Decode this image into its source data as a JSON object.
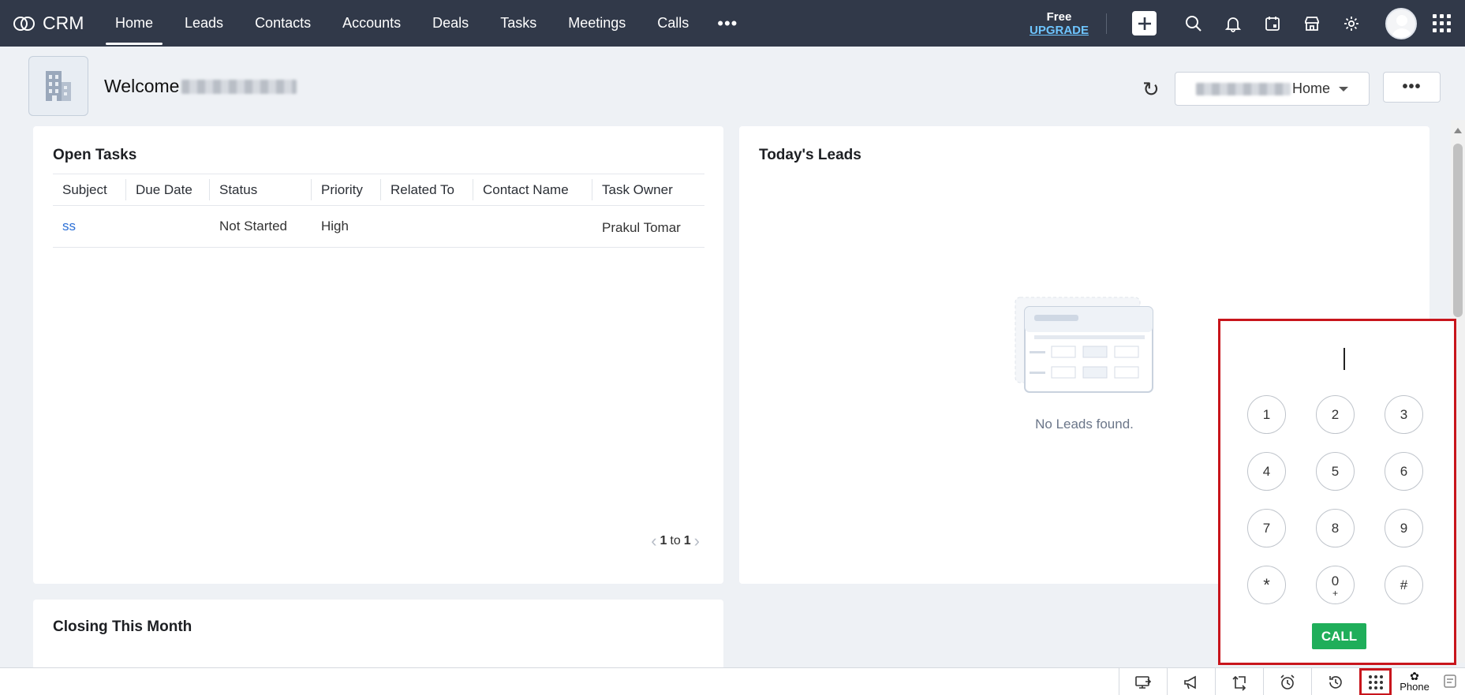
{
  "app": {
    "name": "CRM"
  },
  "nav": {
    "items": [
      {
        "label": "Home",
        "active": true
      },
      {
        "label": "Leads"
      },
      {
        "label": "Contacts"
      },
      {
        "label": "Accounts"
      },
      {
        "label": "Deals"
      },
      {
        "label": "Tasks"
      },
      {
        "label": "Meetings"
      },
      {
        "label": "Calls"
      }
    ],
    "more": "•••",
    "upgrade": {
      "free": "Free",
      "link": "UPGRADE"
    },
    "icons": [
      "plus-icon",
      "search-icon",
      "bell-icon",
      "calendar-icon",
      "marketplace-icon",
      "gear-icon",
      "avatar",
      "apps-grid-icon"
    ]
  },
  "welcome": {
    "prefix": "Welcome",
    "refresh_glyph": "↻",
    "home_view": "Home",
    "more": "•••"
  },
  "open_tasks": {
    "title": "Open Tasks",
    "columns": [
      "Subject",
      "Due Date",
      "Status",
      "Priority",
      "Related To",
      "Contact Name",
      "Task Owner"
    ],
    "rows": [
      {
        "subject": "ss",
        "due_date": "",
        "status": "Not Started",
        "priority": "High",
        "related_to": "",
        "contact_name": "",
        "task_owner": "Prakul Tomar"
      }
    ],
    "pager": {
      "from": "1",
      "sep": "to",
      "to": "1"
    }
  },
  "todays_leads": {
    "title": "Today's Leads",
    "empty_text": "No Leads found."
  },
  "closing": {
    "title": "Closing This Month"
  },
  "dialpad": {
    "keys": [
      {
        "main": "1",
        "sub": ""
      },
      {
        "main": "2",
        "sub": ""
      },
      {
        "main": "3",
        "sub": ""
      },
      {
        "main": "4",
        "sub": ""
      },
      {
        "main": "5",
        "sub": ""
      },
      {
        "main": "6",
        "sub": ""
      },
      {
        "main": "7",
        "sub": ""
      },
      {
        "main": "8",
        "sub": ""
      },
      {
        "main": "9",
        "sub": ""
      },
      {
        "main": "*",
        "sub": ""
      },
      {
        "main": "0",
        "sub": "+"
      },
      {
        "main": "#",
        "sub": ""
      }
    ],
    "call_label": "CALL"
  },
  "bottombar": {
    "icons": [
      "screen-share-icon",
      "megaphone-icon",
      "transfer-icon",
      "alarm-icon",
      "history-icon",
      "dialpad-icon",
      "notes-icon"
    ],
    "phone_label": "Phone",
    "phone_glyph": "✿"
  },
  "colors": {
    "nav_bg": "#313949",
    "accent_red": "#c8151c",
    "call_green": "#1fae5a",
    "link_blue": "#2b6fd6",
    "upgrade_blue": "#6ec5ff"
  }
}
